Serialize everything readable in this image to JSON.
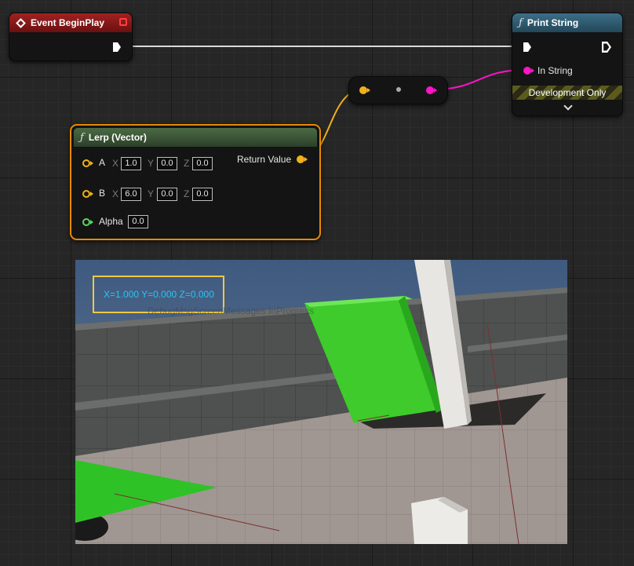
{
  "nodes": {
    "begin_play": {
      "title": "Event BeginPlay"
    },
    "print_string": {
      "title": "Print String",
      "in_string_label": "In String",
      "development_only": "Development Only"
    },
    "lerp": {
      "title": "Lerp (Vector)",
      "return_value_label": "Return Value",
      "pin_a": {
        "label": "A",
        "x": "1.0",
        "y": "0.0",
        "z": "0.0"
      },
      "pin_b": {
        "label": "B",
        "x": "6.0",
        "y": "0.0",
        "z": "0.0"
      },
      "alpha": {
        "label": "Alpha",
        "value": "0.0"
      },
      "axis_labels": {
        "x": "X",
        "y": "Y",
        "z": "Z"
      }
    }
  },
  "viewport": {
    "debug_message": "X=1.000 Y=0.000 Z=0.000",
    "faint_message": "DebugMsgScreenMessages InProgress"
  },
  "colors": {
    "exec_wire": "#ffffff",
    "vector_pin": "#f0b11b",
    "string_pin": "#ff14c8",
    "float_pin": "#5fd55f",
    "selection_outline": "#e68a00",
    "debug_text": "#26c6f2"
  },
  "icons": [
    "event-diamond-icon",
    "function-icon",
    "delegate-square-icon",
    "exec-pin-icon",
    "chevron-down-icon"
  ]
}
